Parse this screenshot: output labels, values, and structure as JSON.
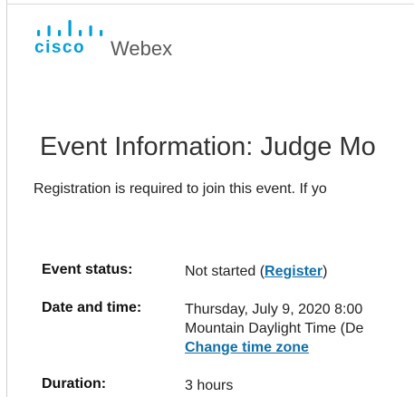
{
  "brand": {
    "company": "cisco",
    "product": "Webex",
    "bar_heights": [
      7,
      12,
      7,
      18,
      7,
      12,
      7
    ],
    "color_company": "#049fd9",
    "color_product": "#5a5a5a"
  },
  "page": {
    "title": "Event Information: Judge Mo",
    "registration_notice": "Registration is required to join this event. If yo"
  },
  "details": {
    "status_label": "Event status:",
    "status_value": "Not started (",
    "register_link": "Register",
    "status_value_end": ")",
    "datetime_label": "Date and time:",
    "datetime_line1": "Thursday, July 9, 2020 8:00",
    "datetime_line2": "Mountain Daylight Time (De",
    "change_timezone_link": "Change time zone",
    "duration_label": "Duration:",
    "duration_value": "3 hours"
  },
  "colors": {
    "link": "#0f6fa8",
    "text": "#222222",
    "title": "#333333"
  }
}
